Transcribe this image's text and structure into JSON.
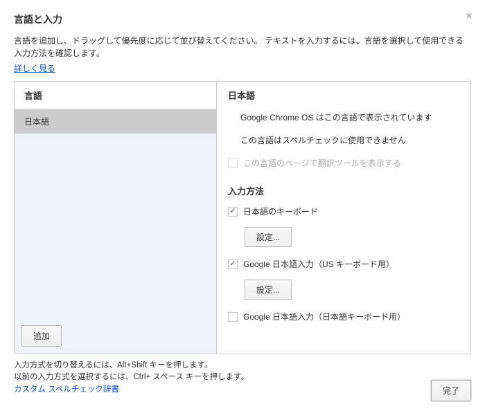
{
  "header": {
    "title": "言語と入力",
    "description": "言語を追加し、ドラッグして優先度に応じて並び替えてください。 テキストを入力するには、言語を選択して使用できる入力方法を確認します。",
    "learn_more": "詳しく見る"
  },
  "left": {
    "heading": "言語",
    "languages": [
      {
        "label": "日本語",
        "selected": true
      }
    ],
    "add_button": "追加"
  },
  "right": {
    "heading": "日本語",
    "chrome_display": "Google Chrome OS はこの言語で表示されています",
    "spellcheck": "この言語はスペルチェックに使用できません",
    "translate_option": "この言語のページで翻訳ツールを表示する",
    "input_section": "入力方法",
    "inputs": [
      {
        "label": "日本語のキーボード",
        "checked": true,
        "has_settings": true
      },
      {
        "label": "Google 日本語入力（US キーボード用）",
        "checked": true,
        "has_settings": true
      },
      {
        "label": "Google 日本語入力（日本語キーボード用）",
        "checked": false,
        "has_settings": false
      }
    ],
    "settings_button": "設定..."
  },
  "footer": {
    "line1": "入力方式を切り替えるには、Alt+Shift キーを押します。",
    "line2": "以前の入力方式を選択するには、Ctrl+ スペース キーを押します。",
    "dictionary_link": "カスタム スペルチェック辞書"
  },
  "buttons": {
    "done": "完了"
  }
}
